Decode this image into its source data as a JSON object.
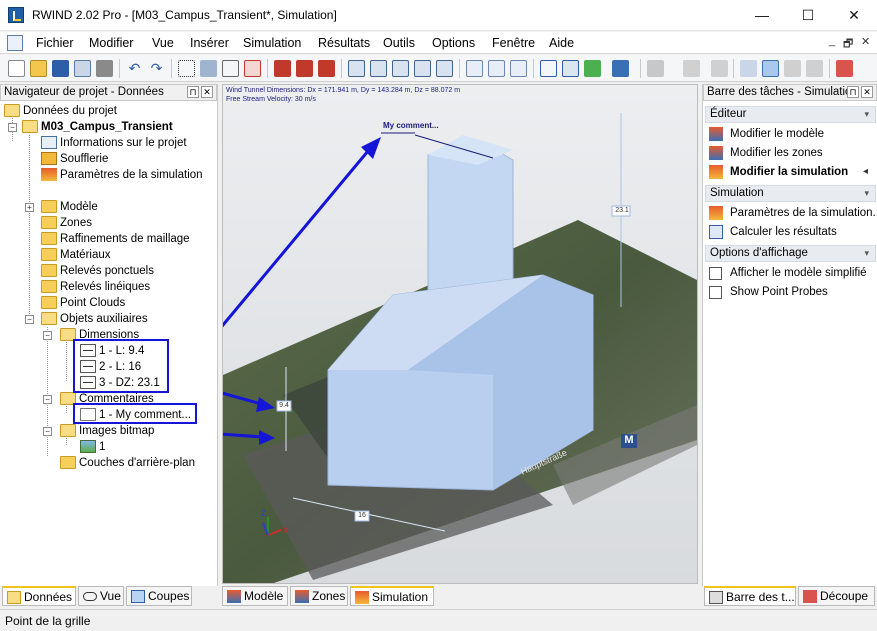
{
  "window": {
    "title": "RWIND 2.02 Pro - [M03_Campus_Transient*, Simulation]",
    "minimize": "—",
    "maximize": "☐",
    "close": "✕"
  },
  "menu": {
    "items": [
      "Fichier",
      "Modifier",
      "Vue",
      "Insérer",
      "Simulation",
      "Résultats",
      "Outils",
      "Options",
      "Fenêtre",
      "Aide"
    ],
    "mdi_min": "_",
    "mdi_restore": "🗗",
    "mdi_close": "✕"
  },
  "navigator": {
    "title": "Navigateur de projet - Données",
    "pin": "⊓",
    "close": "✕",
    "root": "Données du projet",
    "project": "M03_Campus_Transient",
    "items": [
      "Informations sur le projet",
      "Soufflerie",
      "Paramètres de la simulation",
      "Modèle",
      "Zones",
      "Raffinements de maillage",
      "Matériaux",
      "Relevés ponctuels",
      "Relevés linéiques",
      "Point Clouds",
      "Objets auxiliaires"
    ],
    "aux": {
      "dimensions": "Dimensions",
      "dim_items": [
        "1 - L: 9.4",
        "2 - L: 16",
        "3 - DZ: 23.1"
      ],
      "comments": "Commentaires",
      "comment_items": [
        "1 - My comment..."
      ],
      "images": "Images bitmap",
      "image_items": [
        "1"
      ],
      "background": "Couches d'arrière-plan"
    },
    "tabs": [
      "Données",
      "Vue",
      "Coupes"
    ]
  },
  "viewport": {
    "info_line1": "Wind Tunnel Dimensions: Dx = 171.941 m, Dy = 143.284 m, Dz = 88.072 m",
    "info_line2": "Free Stream Velocity: 30 m/s",
    "comment_label": "My comment...",
    "dim_label_1": "9.4",
    "dim_label_2": "16",
    "dim_label_3": "23.1",
    "road_label": "Hauptstraße",
    "metro": "M",
    "axis_z": "Z",
    "axis_x": "X",
    "tabs": [
      "Modèle",
      "Zones",
      "Simulation"
    ]
  },
  "taskpane": {
    "title": "Barre des tâches - Simulation",
    "pin": "⊓",
    "close": "✕",
    "sections": [
      {
        "title": "Éditeur",
        "items": [
          "Modifier le modèle",
          "Modifier les zones",
          "Modifier la simulation"
        ]
      },
      {
        "title": "Simulation",
        "items": [
          "Paramètres de la simulation...",
          "Calculer les résultats"
        ]
      },
      {
        "title": "Options d'affichage",
        "items": [
          "Afficher le modèle simplifié",
          "Show Point Probes"
        ]
      }
    ],
    "tabs": [
      "Barre des t...",
      "Découpe"
    ]
  },
  "status": {
    "text": "Point de la grille"
  },
  "colors": {
    "highlight": "#1515d8",
    "building": "#b8cff0",
    "accent": "#f0c419"
  }
}
